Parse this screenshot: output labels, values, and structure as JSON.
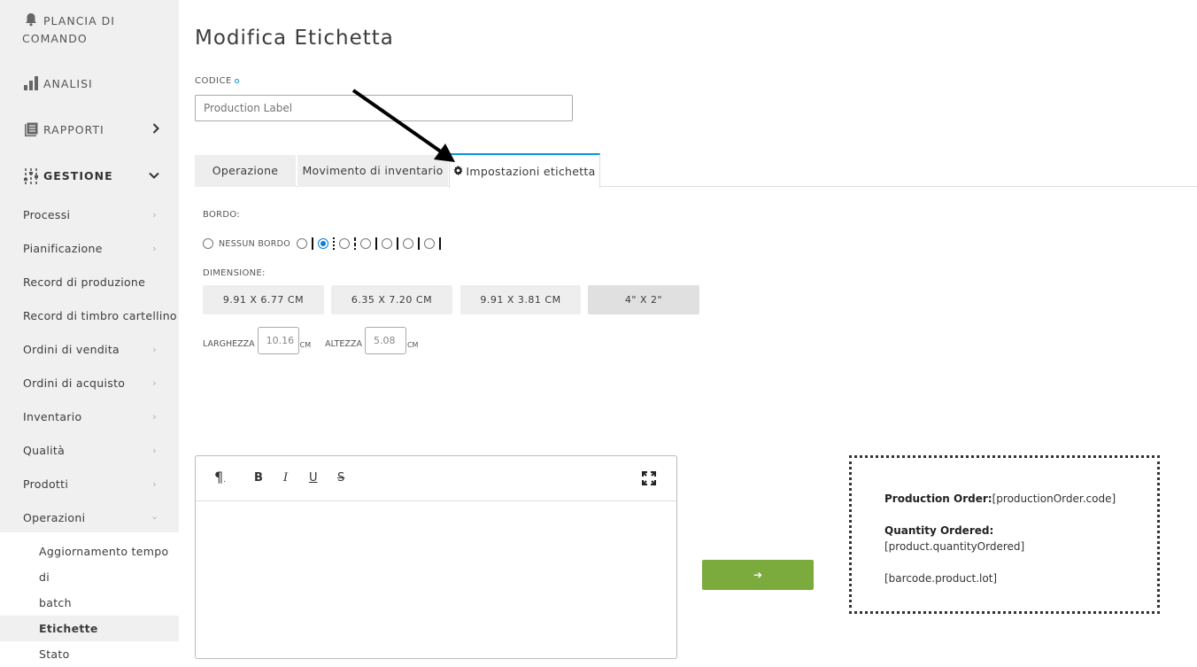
{
  "sidebar": {
    "top": [
      {
        "label_line1": "PLANCIA DI",
        "label_line2": "COMANDO",
        "icon": "bell-icon"
      },
      {
        "label": "ANALISI",
        "icon": "bar-chart-icon"
      },
      {
        "label": "RAPPORTI",
        "icon": "report-icon"
      },
      {
        "label": "GESTIONE",
        "icon": "sliders-icon"
      }
    ],
    "items": [
      {
        "label": "Processi"
      },
      {
        "label": "Pianificazione"
      },
      {
        "label": "Record di produzione"
      },
      {
        "label": "Record di timbro cartellino"
      },
      {
        "label": "Ordini di vendita"
      },
      {
        "label": "Ordini di acquisto"
      },
      {
        "label": "Inventario"
      },
      {
        "label": "Qualità"
      },
      {
        "label": "Prodotti"
      },
      {
        "label": "Operazioni"
      }
    ],
    "subitems": [
      {
        "label_line1": "Aggiornamento tempo di",
        "label_line2": "batch"
      },
      {
        "label": "Etichette"
      },
      {
        "label": "Stato"
      }
    ]
  },
  "main": {
    "title": "Modifica Etichetta",
    "code_label": "CODICE",
    "code_placeholder": "Production Label",
    "tabs": [
      {
        "label": "Operazione"
      },
      {
        "label": "Movimento di inventario"
      },
      {
        "label": "Impostazioni etichetta",
        "icon": "gear-icon"
      }
    ],
    "border_label": "BORDO:",
    "no_border_label": "NESSUN BORDO",
    "dimension_label": "DIMENSIONE:",
    "sizes": [
      "9.91 X 6.77 CM",
      "6.35 X 7.20 CM",
      "9.91 X 3.81 CM",
      "4\" X 2\""
    ],
    "width_label": "LARGHEZZA",
    "width_value": "10.16",
    "height_label": "ALTEZZA",
    "height_value": "5.08",
    "unit": "CM",
    "toolbar": {
      "paragraph": "¶",
      "bold": "B",
      "italic": "I",
      "underline": "U",
      "strike": "S"
    },
    "apply_icon": "➔",
    "preview": {
      "line1_bold": "Production Order:",
      "line1_value": "[productionOrder.code]",
      "line2_bold": "Quantity Ordered:",
      "line3": "[product.quantityOrdered]",
      "line4": "[barcode.product.lot]"
    }
  }
}
